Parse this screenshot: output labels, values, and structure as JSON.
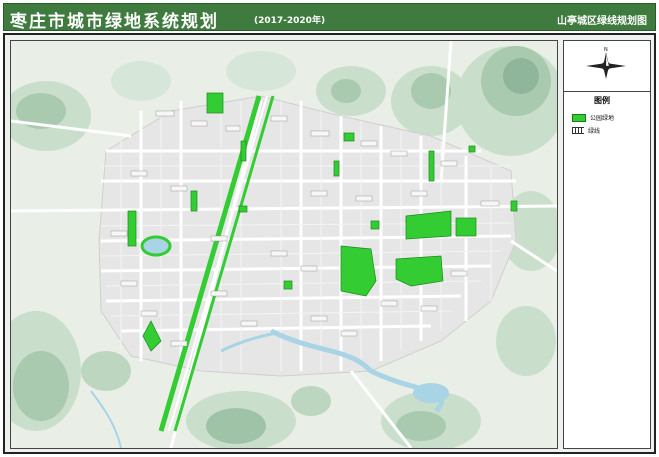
{
  "header": {
    "title": "枣庄市城市绿地系统规划",
    "years": "(2017-2020年)",
    "subtitle": "山亭城区绿线规划图"
  },
  "compass": {
    "north_label": "N"
  },
  "legend": {
    "title": "图例",
    "items": [
      {
        "label": "公园绿地",
        "swatch": "park-green"
      },
      {
        "label": "绿线",
        "swatch": "green-line"
      }
    ]
  },
  "colors": {
    "header_bg": "#3f7a3f",
    "park_green": "#33cc33",
    "water": "#a8d4e6",
    "hill_dark": "#8fb59a",
    "hill_light": "#c9dfcc",
    "urban_block": "#e3e3e3",
    "road": "#ffffff"
  }
}
